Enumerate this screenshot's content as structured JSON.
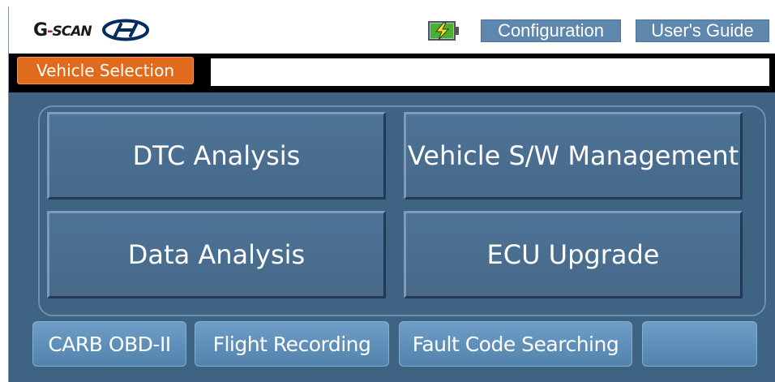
{
  "header": {
    "logo_text_g": "G",
    "logo_text_dash": "-",
    "logo_text_rest": "SCAN",
    "config_label": "Configuration",
    "guide_label": "User's Guide"
  },
  "vehicle_bar": {
    "button_label": "Vehicle Selection",
    "field_value": ""
  },
  "main": {
    "buttons": [
      {
        "label": "DTC Analysis"
      },
      {
        "label": "Vehicle S/W Management"
      },
      {
        "label": "Data Analysis"
      },
      {
        "label": "ECU Upgrade"
      }
    ]
  },
  "footer": {
    "buttons": [
      {
        "label": "CARB OBD-II"
      },
      {
        "label": "Flight Recording"
      },
      {
        "label": "Fault Code Searching"
      },
      {
        "label": ""
      }
    ]
  },
  "colors": {
    "background": "#3f6382",
    "accent_orange": "#e06b1c",
    "header_button": "#5d87ad",
    "battery_green": "#4caf2a"
  },
  "icons": [
    "g-scan-logo-icon",
    "hyundai-logo-icon",
    "battery-charging-icon"
  ]
}
